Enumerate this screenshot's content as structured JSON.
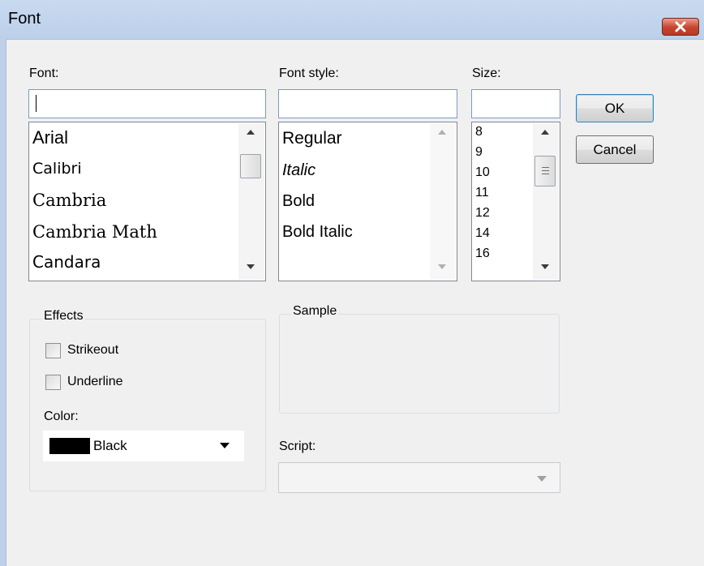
{
  "window": {
    "title": "Font"
  },
  "font": {
    "label": "Font:",
    "value": "",
    "items": [
      "Arial",
      "Calibri",
      "Cambria",
      "Cambria Math",
      "Candara"
    ]
  },
  "style": {
    "label": "Font style:",
    "value": "",
    "items": [
      "Regular",
      "Italic",
      "Bold",
      "Bold Italic"
    ]
  },
  "size": {
    "label": "Size:",
    "value": "",
    "items": [
      "8",
      "9",
      "10",
      "11",
      "12",
      "14",
      "16"
    ]
  },
  "buttons": {
    "ok": "OK",
    "cancel": "Cancel"
  },
  "effects": {
    "legend": "Effects",
    "strikeout": {
      "label": "Strikeout",
      "checked": false
    },
    "underline": {
      "label": "Underline",
      "checked": false
    },
    "color_label": "Color:",
    "color_value": "Black",
    "color_swatch": "#000000"
  },
  "sample": {
    "legend": "Sample"
  },
  "script": {
    "label": "Script:",
    "value": ""
  },
  "icons": {
    "close": "close-icon",
    "scroll_up": "scroll-up-arrow-icon",
    "scroll_down": "scroll-down-arrow-icon",
    "dropdown": "chevron-down-icon"
  },
  "colors": {
    "titlebar": "#bcd0ea",
    "close_button": "#c7442e",
    "dialog_bg": "#f0f0f0"
  }
}
